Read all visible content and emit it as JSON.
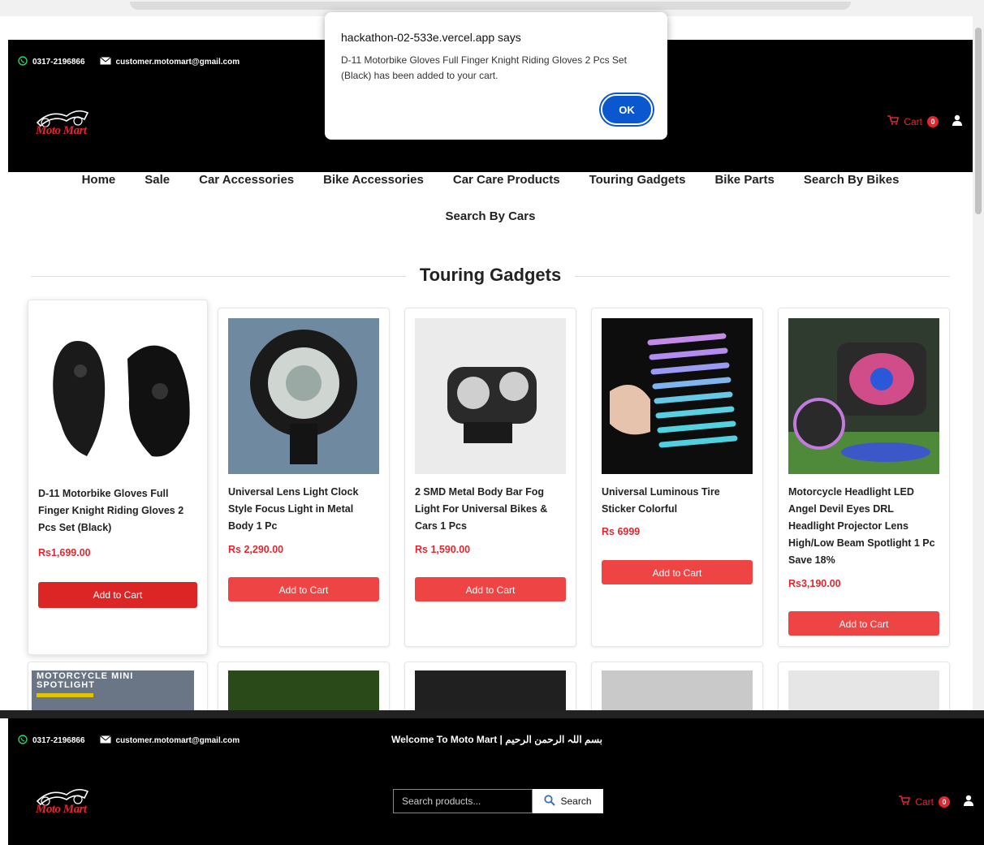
{
  "browser": {
    "dialog": {
      "title": "hackathon-02-533e.vercel.app says",
      "message": "D-11 Motorbike Gloves Full Finger Knight Riding Gloves 2 Pcs Set (Black) has been added to your cart.",
      "ok_label": "OK"
    }
  },
  "header": {
    "phone": "0317-2196866",
    "email": "customer.motomart@gmail.com",
    "logo_text": "Moto Mart",
    "cart_label": "Cart",
    "cart_count": "0",
    "welcome": "Welcome To Moto Mart | بسم اللہ الرحمن الرحیم",
    "search_placeholder": "Search products...",
    "search_button": "Search"
  },
  "nav": {
    "items": [
      "Home",
      "Sale",
      "Car Accessories",
      "Bike Accessories",
      "Car Care Products",
      "Touring Gadgets",
      "Bike Parts",
      "Search By Bikes",
      "Search By Cars"
    ]
  },
  "section": {
    "title": "Touring Gadgets"
  },
  "products": [
    {
      "name": "D-11 Motorbike Gloves Full Finger Knight Riding Gloves 2 Pcs Set (Black)",
      "price": "Rs1,699.00",
      "button": "Add to Cart"
    },
    {
      "name": "Universal Lens Light Clock Style Focus Light in Metal Body 1 Pc",
      "price": "Rs 2,290.00",
      "button": "Add to Cart"
    },
    {
      "name": "2 SMD Metal Body Bar Fog Light For Universal Bikes & Cars 1 Pcs",
      "price": "Rs 1,590.00",
      "button": "Add to Cart"
    },
    {
      "name": "Universal Luminous Tire Sticker Colorful",
      "price": "Rs 6999",
      "button": "Add to Cart"
    },
    {
      "name": "Motorcycle Headlight LED Angel Devil Eyes DRL Headlight Projector Lens High/Low Beam Spotlight 1 Pc Save 18%",
      "price": "Rs3,190.00",
      "button": "Add to Cart"
    }
  ],
  "row2_first_image_text": "MOTORCYCLE MINI SPOTLIGHT",
  "colors": {
    "accent": "#e3262f",
    "button": "#ef4444",
    "dialog_button": "#0b57d0"
  }
}
